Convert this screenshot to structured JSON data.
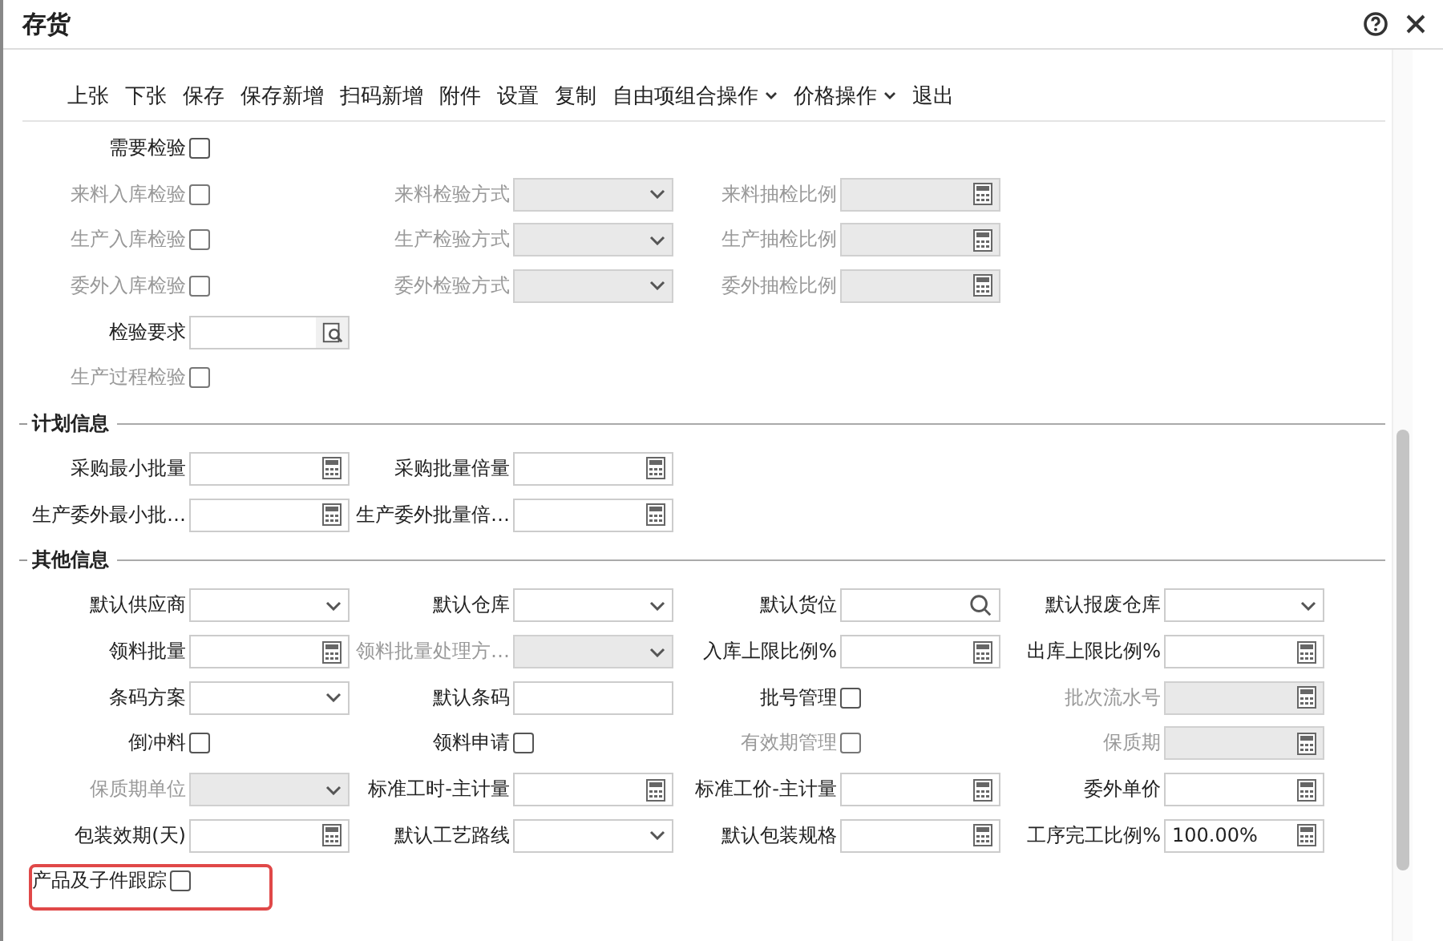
{
  "window": {
    "title": "存货"
  },
  "toolbar": [
    {
      "label": "上张",
      "dropdown": false
    },
    {
      "label": "下张",
      "dropdown": false
    },
    {
      "label": "保存",
      "dropdown": false
    },
    {
      "label": "保存新增",
      "dropdown": false
    },
    {
      "label": "扫码新增",
      "dropdown": false
    },
    {
      "label": "附件",
      "dropdown": false
    },
    {
      "label": "设置",
      "dropdown": false
    },
    {
      "label": "复制",
      "dropdown": false
    },
    {
      "label": "自由项组合操作",
      "dropdown": true
    },
    {
      "label": "价格操作",
      "dropdown": true
    },
    {
      "label": "退出",
      "dropdown": false
    }
  ],
  "sections": [
    {
      "rows": [
        [
          {
            "kind": "check",
            "label": "需要检验",
            "disabled": false,
            "checked": false
          }
        ],
        [
          {
            "kind": "check",
            "label": "来料入库检验",
            "disabled": true,
            "checked": false
          },
          {
            "kind": "select",
            "label": "来料检验方式",
            "disabled": true
          },
          {
            "kind": "calc",
            "label": "来料抽检比例",
            "disabled": true
          }
        ],
        [
          {
            "kind": "check",
            "label": "生产入库检验",
            "disabled": true,
            "checked": false
          },
          {
            "kind": "select",
            "label": "生产检验方式",
            "disabled": true
          },
          {
            "kind": "calc",
            "label": "生产抽检比例",
            "disabled": true
          }
        ],
        [
          {
            "kind": "check",
            "label": "委外入库检验",
            "disabled": true,
            "checked": false
          },
          {
            "kind": "select",
            "label": "委外检验方式",
            "disabled": true
          },
          {
            "kind": "calc",
            "label": "委外抽检比例",
            "disabled": true
          }
        ],
        [
          {
            "kind": "lookup",
            "label": "检验要求",
            "disabled": false
          }
        ],
        [
          {
            "kind": "check",
            "label": "生产过程检验",
            "disabled": true,
            "checked": false
          }
        ]
      ]
    },
    {
      "title": "计划信息",
      "rows": [
        [
          {
            "kind": "calc",
            "label": "采购最小批量",
            "disabled": false
          },
          {
            "kind": "calc",
            "label": "采购批量倍量",
            "disabled": false
          }
        ],
        [
          {
            "kind": "calc",
            "label": "生产委外最小批…",
            "disabled": false
          },
          {
            "kind": "calc",
            "label": "生产委外批量倍…",
            "disabled": false
          }
        ]
      ]
    },
    {
      "title": "其他信息",
      "rows": [
        [
          {
            "kind": "select",
            "label": "默认供应商",
            "disabled": false
          },
          {
            "kind": "select",
            "label": "默认仓库",
            "disabled": false
          },
          {
            "kind": "search",
            "label": "默认货位",
            "disabled": false
          },
          {
            "kind": "select",
            "label": "默认报废仓库",
            "disabled": false
          }
        ],
        [
          {
            "kind": "calc",
            "label": "领料批量",
            "disabled": false
          },
          {
            "kind": "select",
            "label": "领料批量处理方…",
            "disabled": true
          },
          {
            "kind": "calc",
            "label": "入库上限比例%",
            "disabled": false
          },
          {
            "kind": "calc",
            "label": "出库上限比例%",
            "disabled": false
          }
        ],
        [
          {
            "kind": "select",
            "label": "条码方案",
            "disabled": false
          },
          {
            "kind": "text",
            "label": "默认条码",
            "disabled": false
          },
          {
            "kind": "check",
            "label": "批号管理",
            "disabled": false,
            "checked": false
          },
          {
            "kind": "calc",
            "label": "批次流水号",
            "disabled": true
          }
        ],
        [
          {
            "kind": "check",
            "label": "倒冲料",
            "disabled": false,
            "checked": false
          },
          {
            "kind": "check",
            "label": "领料申请",
            "disabled": false,
            "checked": false
          },
          {
            "kind": "check",
            "label": "有效期管理",
            "disabled": true,
            "checked": false
          },
          {
            "kind": "calc",
            "label": "保质期",
            "disabled": true
          }
        ],
        [
          {
            "kind": "select",
            "label": "保质期单位",
            "disabled": true
          },
          {
            "kind": "calc",
            "label": "标准工时-主计量",
            "disabled": false
          },
          {
            "kind": "calc",
            "label": "标准工价-主计量",
            "disabled": false
          },
          {
            "kind": "calc",
            "label": "委外单价",
            "disabled": false
          }
        ],
        [
          {
            "kind": "calc",
            "label": "包装效期(天)",
            "disabled": false
          },
          {
            "kind": "select",
            "label": "默认工艺路线",
            "disabled": false
          },
          {
            "kind": "calc",
            "label": "默认包装规格",
            "disabled": false
          },
          {
            "kind": "calc",
            "label": "工序完工比例%",
            "disabled": false,
            "value": "100.00%"
          }
        ],
        [
          {
            "kind": "check",
            "label": "产品及子件跟踪",
            "disabled": false,
            "checked": false,
            "highlighted": true
          }
        ]
      ]
    }
  ]
}
